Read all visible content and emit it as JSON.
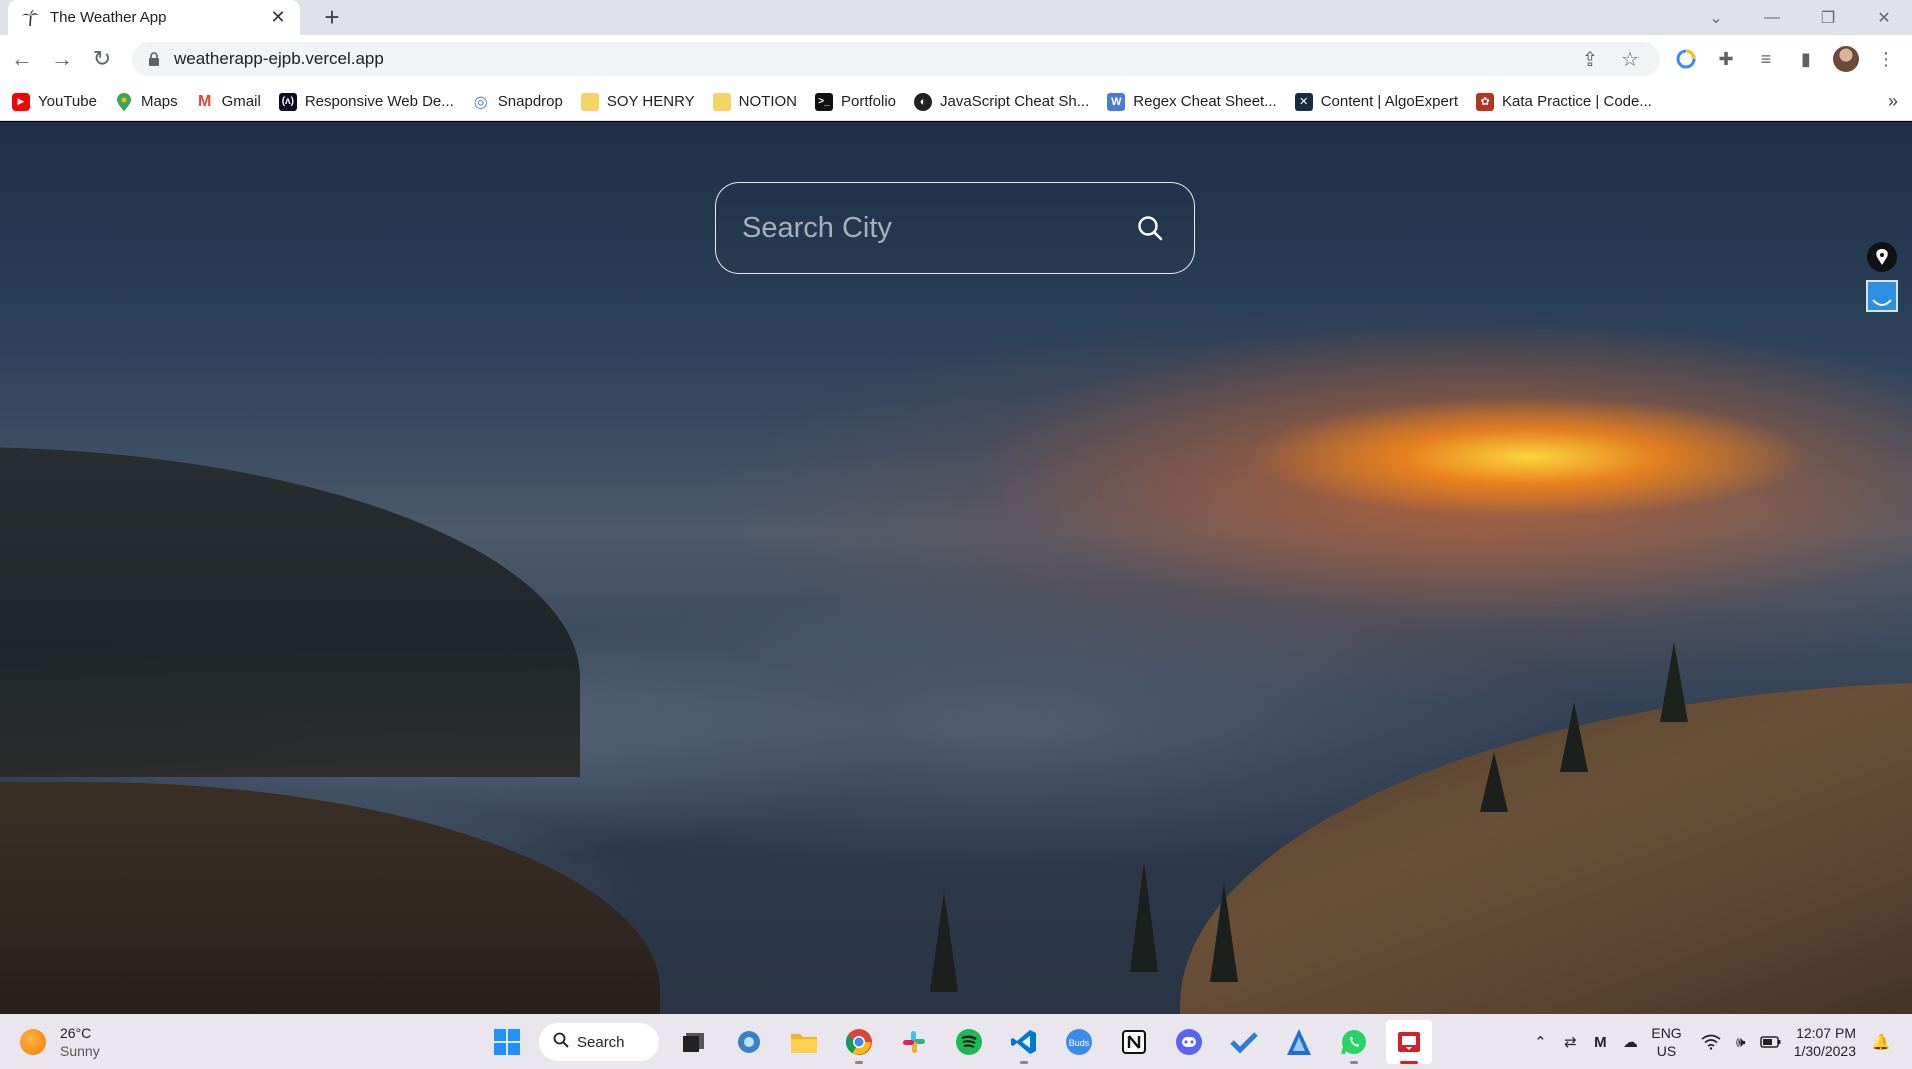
{
  "browser": {
    "tab": {
      "title": "The Weather App",
      "close_glyph": "✕"
    },
    "new_tab_glyph": "+",
    "address": {
      "url": "weatherapp-ejpb.vercel.app"
    },
    "bookmarks": [
      {
        "label": "YouTube",
        "icon": "youtube-icon",
        "color": "#ff0000"
      },
      {
        "label": "Maps",
        "icon": "maps-icon",
        "color": "#34a853"
      },
      {
        "label": "Gmail",
        "icon": "gmail-icon",
        "color": "#ea4335"
      },
      {
        "label": "Responsive Web De...",
        "icon": "freecodecamp-icon",
        "color": "#0a0a23"
      },
      {
        "label": "Snapdrop",
        "icon": "snapdrop-icon",
        "color": "#3f7be0"
      },
      {
        "label": "SOY HENRY",
        "icon": "folder-icon",
        "color": "#f6d365"
      },
      {
        "label": "NOTION",
        "icon": "folder-icon",
        "color": "#f6d365"
      },
      {
        "label": "Portfolio",
        "icon": "terminal-icon",
        "color": "#111111"
      },
      {
        "label": "JavaScript Cheat Sh...",
        "icon": "globe-icon",
        "color": "#222222"
      },
      {
        "label": "Regex Cheat Sheet...",
        "icon": "w-icon",
        "color": "#4a7bd6"
      },
      {
        "label": "Content | AlgoExpert",
        "icon": "algoexpert-icon",
        "color": "#1a2a44"
      },
      {
        "label": "Kata Practice | Code...",
        "icon": "codewars-icon",
        "color": "#b1361e"
      }
    ],
    "bookmarks_more": "»"
  },
  "app": {
    "search": {
      "placeholder": "Search City",
      "value": ""
    }
  },
  "taskbar": {
    "weather": {
      "temp": "26°C",
      "condition": "Sunny"
    },
    "search_label": "Search",
    "lang": {
      "line1": "ENG",
      "line2": "US"
    },
    "clock": {
      "time": "12:07 PM",
      "date": "1/30/2023"
    }
  },
  "colors": {
    "accent_red": "#d3202d",
    "sun_orange": "#f57c00"
  }
}
